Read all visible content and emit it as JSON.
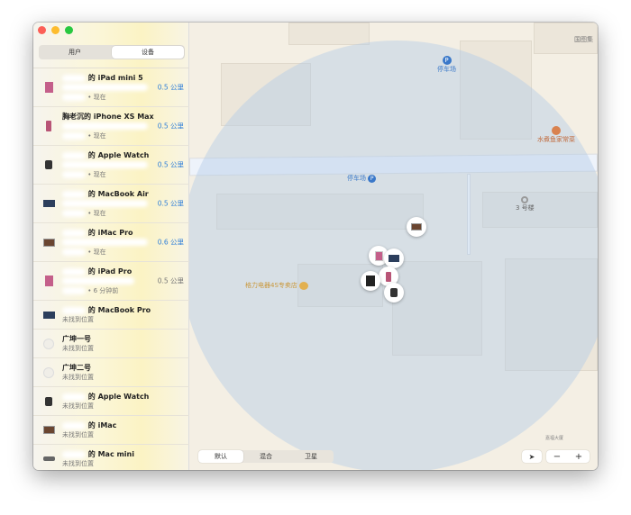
{
  "tabs": [
    "用户",
    "设备"
  ],
  "selected_tab": "设备",
  "devices": [
    {
      "name": "的 iPad mini 5",
      "status": "现在",
      "distance": "0.5 公里",
      "icon": "ipad-icon"
    },
    {
      "name": "胸老沉的 iPhone XS Max",
      "status": "现在",
      "distance": "0.5 公里",
      "icon": "iphone-icon"
    },
    {
      "name": "的 Apple Watch",
      "status": "现在",
      "distance": "0.5 公里",
      "icon": "watch-icon"
    },
    {
      "name": "的 MacBook Air",
      "status": "现在",
      "distance": "0.5 公里",
      "icon": "macbook-icon"
    },
    {
      "name": "的 iMac Pro",
      "status": "现在",
      "distance": "0.6 公里",
      "icon": "imac-icon"
    },
    {
      "name": "的 iPad Pro",
      "status": "6 分钟前",
      "distance": "0.5 公里",
      "icon": "ipad-icon"
    },
    {
      "name": "的 MacBook Pro",
      "status": "未找到位置",
      "icon": "macbook-icon"
    },
    {
      "name": "广坤一号",
      "status": "未找到位置",
      "icon": "airpods-icon"
    },
    {
      "name": "广坤二号",
      "status": "未找到位置",
      "icon": "airpods-icon"
    },
    {
      "name": "的 Apple Watch",
      "status": "未找到位置",
      "icon": "watch-icon"
    },
    {
      "name": "的 iMac",
      "status": "未找到位置",
      "icon": "imac-icon"
    },
    {
      "name": "的 Mac mini",
      "status": "未找到位置",
      "icon": "mac-mini-icon"
    }
  ],
  "map": {
    "labels": {
      "parking1": "停车场",
      "parking2": "停车场",
      "restaurant": "水煮鱼家常菜",
      "building3": "3 号楼",
      "store": "格力电器4S专卖店",
      "top_right": "国图集",
      "bottom_right": "嘉福大厦"
    },
    "modes": [
      "默认",
      "混合",
      "卫星"
    ],
    "selected_mode": "默认",
    "zoom_out": "−",
    "zoom_in": "+"
  },
  "colors": {
    "accent": "#2f7fd8",
    "close": "#fc5f57",
    "minimize": "#fdbc2e",
    "zoom": "#28c840"
  }
}
